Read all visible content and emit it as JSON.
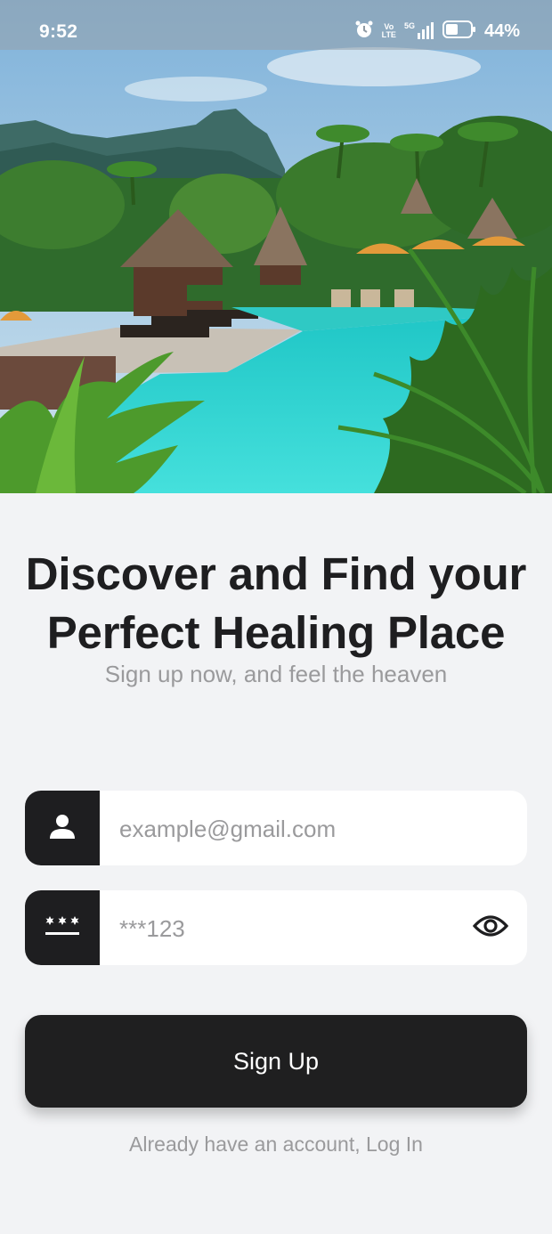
{
  "status_bar": {
    "time": "9:52",
    "alarm_icon": "alarm-clock-icon",
    "volte_top": "Vo",
    "volte_bottom": "LTE",
    "network": "5G",
    "battery_percent": "44%"
  },
  "hero": {
    "scene": "tropical-resort-pool-photo"
  },
  "headline": {
    "line1": "Discover and Find your",
    "line2": "Perfect Healing Place"
  },
  "subheadline": "Sign up now, and feel the heaven",
  "form": {
    "email": {
      "icon": "person-icon",
      "placeholder": "example@gmail.com",
      "value": ""
    },
    "password": {
      "icon": "password-dots-icon",
      "placeholder": "***123",
      "value": "",
      "toggle_icon": "eye-icon"
    }
  },
  "signup_button": "Sign Up",
  "login_prompt": "Already have an account, Log In",
  "colors": {
    "background": "#f2f3f5",
    "dark": "#1e1e20",
    "muted_text": "#9a9a9c",
    "pool": "#27d3cf"
  }
}
